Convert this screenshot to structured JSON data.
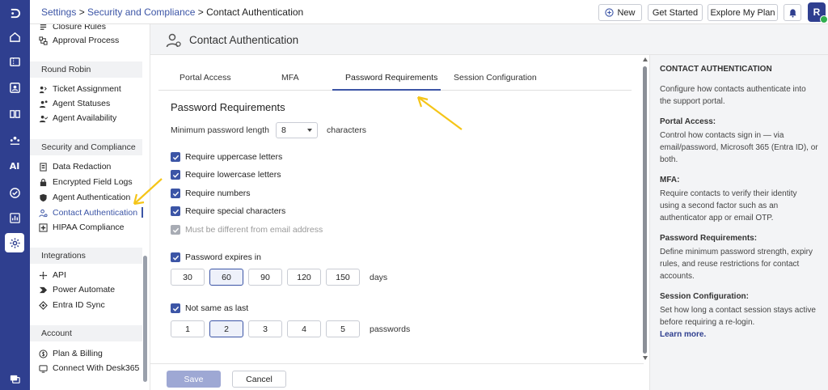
{
  "breadcrumb": {
    "root": "Settings",
    "sep1": " > ",
    "section": "Security and Compliance",
    "sep2": " > ",
    "current": "Contact Authentication"
  },
  "topbar": {
    "new_label": "New",
    "get_started_label": "Get Started",
    "explore_label": "Explore My Plan",
    "avatar_initial": "R"
  },
  "rail": {
    "ai_label": "AI"
  },
  "sidebar": {
    "top_items": [
      {
        "label": "Closure Rules",
        "icon": "rules-icon"
      },
      {
        "label": "Approval Process",
        "icon": "approval-icon"
      }
    ],
    "round_robin": {
      "heading": "Round Robin",
      "items": [
        {
          "label": "Ticket Assignment",
          "icon": "ticket-icon"
        },
        {
          "label": "Agent Statuses",
          "icon": "status-icon"
        },
        {
          "label": "Agent Availability",
          "icon": "availability-icon"
        }
      ]
    },
    "security": {
      "heading": "Security and Compliance",
      "items": [
        {
          "label": "Data Redaction",
          "icon": "redaction-icon"
        },
        {
          "label": "Encrypted Field Logs",
          "icon": "encrypted-icon"
        },
        {
          "label": "Agent Authentication",
          "icon": "shield-icon"
        },
        {
          "label": "Contact Authentication",
          "icon": "contact-auth-icon"
        },
        {
          "label": "HIPAA Compliance",
          "icon": "hipaa-icon"
        }
      ]
    },
    "integrations": {
      "heading": "Integrations",
      "items": [
        {
          "label": "API",
          "icon": "api-icon"
        },
        {
          "label": "Power Automate",
          "icon": "power-automate-icon"
        },
        {
          "label": "Entra ID Sync",
          "icon": "sync-icon"
        }
      ]
    },
    "account": {
      "heading": "Account",
      "items": [
        {
          "label": "Plan & Billing",
          "icon": "billing-icon"
        },
        {
          "label": "Connect With Desk365",
          "icon": "connect-icon"
        }
      ]
    }
  },
  "page": {
    "title": "Contact Authentication"
  },
  "tabs": [
    {
      "label": "Portal Access"
    },
    {
      "label": "MFA"
    },
    {
      "label": "Password Requirements",
      "active": true
    },
    {
      "label": "Session Configuration"
    }
  ],
  "form": {
    "section_title": "Password Requirements",
    "min_length_label": "Minimum password length",
    "min_length_value": "8",
    "min_length_unit": "characters",
    "checks": [
      {
        "label": "Require uppercase letters",
        "checked": true
      },
      {
        "label": "Require lowercase letters",
        "checked": true
      },
      {
        "label": "Require numbers",
        "checked": true
      },
      {
        "label": "Require special characters",
        "checked": true
      },
      {
        "label": "Must be different from email address",
        "checked": true,
        "disabled": true
      }
    ],
    "expires_label": "Password expires in",
    "expires_options": [
      "30",
      "60",
      "90",
      "120",
      "150"
    ],
    "expires_selected": "60",
    "expires_unit": "days",
    "not_same_label": "Not same as last",
    "history_options": [
      "1",
      "2",
      "3",
      "4",
      "5"
    ],
    "history_selected": "2",
    "history_unit": "passwords",
    "save_label": "Save",
    "cancel_label": "Cancel"
  },
  "help": {
    "title": "CONTACT AUTHENTICATION",
    "intro": "Configure how contacts authenticate into the support portal.",
    "sections": [
      {
        "heading": "Portal Access:",
        "text": "Control how contacts sign in — via email/password, Microsoft 365 (Entra ID), or both."
      },
      {
        "heading": "MFA:",
        "text": "Require contacts to verify their identity using a second factor such as an authenticator app or email OTP."
      },
      {
        "heading": "Password Requirements:",
        "text": "Define minimum password strength, expiry rules, and reuse restrictions for contact accounts."
      },
      {
        "heading": "Session Configuration:",
        "text": "Set how long a contact session stays active before requiring a re-login."
      }
    ],
    "learn_more": "Learn more."
  },
  "colors": {
    "rail": "#2f3f8f",
    "accent": "#3c55a6",
    "annotation_arrow": "#f5c518"
  }
}
